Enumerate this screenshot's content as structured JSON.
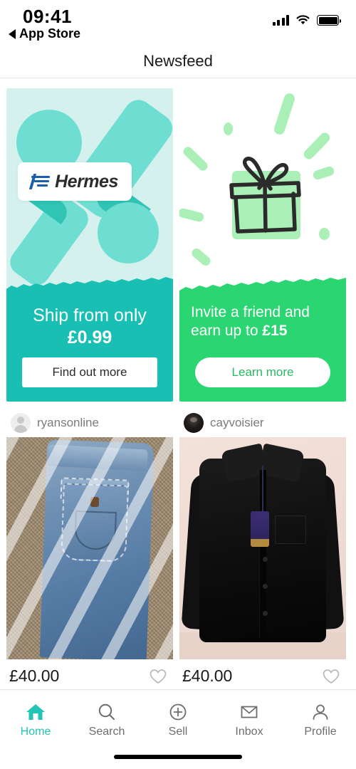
{
  "status_bar": {
    "time": "09:41",
    "back_label": "App Store",
    "icons": [
      "signal-icon",
      "wifi-icon",
      "battery-icon"
    ]
  },
  "nav": {
    "title": "Newsfeed"
  },
  "promos": [
    {
      "id": "hermes",
      "brand_logo_text": "Hermes",
      "headline_prefix": "Ship from only ",
      "headline_strong": "£0.99",
      "button_label": "Find out more",
      "colors": {
        "top_bg": "#d5f1ee",
        "shape": "#6fded2",
        "shape_shade": "#2fc4b4",
        "bottom_bg": "#18bfb2",
        "button_text": "#2b2b2b"
      }
    },
    {
      "id": "invite",
      "headline_prefix": "Invite a friend and earn up to ",
      "headline_strong": "£15",
      "button_label": "Learn more",
      "icon": "gift-box-icon",
      "colors": {
        "top_bg": "#ffffff",
        "ray": "#aaf0b6",
        "bottom_bg": "#2ad572",
        "button_text": "#2ab863"
      }
    }
  ],
  "listings": [
    {
      "seller": "ryansonline",
      "avatar": "default-avatar-icon",
      "price": "£40.00",
      "favorite_icon": "heart-outline-icon",
      "image": "blue-denim-jeans-on-carpet"
    },
    {
      "seller": "cayvoisier",
      "avatar": "photo-avatar",
      "price": "£40.00",
      "favorite_icon": "heart-outline-icon",
      "image": "black-jacket-with-tag"
    }
  ],
  "tabbar": {
    "active": "Home",
    "active_color": "#25c4b6",
    "items": [
      {
        "label": "Home",
        "icon": "home-icon"
      },
      {
        "label": "Search",
        "icon": "search-icon"
      },
      {
        "label": "Sell",
        "icon": "plus-circle-icon"
      },
      {
        "label": "Inbox",
        "icon": "envelope-icon"
      },
      {
        "label": "Profile",
        "icon": "person-icon"
      }
    ]
  }
}
